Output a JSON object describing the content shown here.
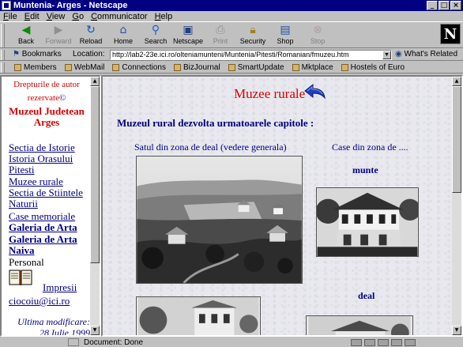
{
  "window": {
    "title": "Muntenia- Arges - Netscape"
  },
  "menu": [
    "File",
    "Edit",
    "View",
    "Go",
    "Communicator",
    "Help"
  ],
  "toolbar": {
    "buttons": [
      {
        "label": "Back",
        "icon": "back-arrow-icon",
        "enabled": true
      },
      {
        "label": "Forward",
        "icon": "forward-arrow-icon",
        "enabled": false
      },
      {
        "label": "Reload",
        "icon": "reload-icon",
        "enabled": true
      },
      {
        "label": "Home",
        "icon": "home-icon",
        "enabled": true
      },
      {
        "label": "Search",
        "icon": "search-icon",
        "enabled": true
      },
      {
        "label": "Netscape",
        "icon": "netscape-icon",
        "enabled": true
      },
      {
        "label": "Print",
        "icon": "print-icon",
        "enabled": false
      },
      {
        "label": "Security",
        "icon": "security-lock-icon",
        "enabled": true
      },
      {
        "label": "Shop",
        "icon": "shop-icon",
        "enabled": true
      },
      {
        "label": "Stop",
        "icon": "stop-icon",
        "enabled": false
      }
    ],
    "logo": "N"
  },
  "location": {
    "bookmarks_label": "Bookmarks",
    "label": "Location:",
    "url": "http://lab2-23e.ici.ro/olteniamunteni/Muntenia/Pitesti/Romanian/fmuzeu.htm",
    "related_label": "What's Related"
  },
  "personal_toolbar": [
    "Members",
    "WebMail",
    "Connections",
    "BizJournal",
    "SmartUpdate",
    "Mktplace",
    "Hostels of Euro"
  ],
  "sidebar": {
    "rights_line1": "Drepturile de autor",
    "rights_line2": "rezervate",
    "copyright": "©",
    "museum_line1": "Muzeul  Judetean",
    "museum_line2": "Arges",
    "links": [
      {
        "label": "Sectia de Istorie",
        "bold": false,
        "link": true
      },
      {
        "label": "Istoria Orasului",
        "bold": false,
        "link": true
      },
      {
        "label": "Pitesti",
        "bold": false,
        "link": true
      },
      {
        "label": "Muzee rurale",
        "bold": false,
        "link": true
      },
      {
        "label": "Sectia de Stiintele",
        "bold": false,
        "link": true
      },
      {
        "label": "Naturii",
        "bold": false,
        "link": true
      },
      {
        "label": "Case memoriale",
        "bold": false,
        "link": true
      },
      {
        "label": "Galeria de Arta",
        "bold": true,
        "link": true
      },
      {
        "label": "Galeria de Arta",
        "bold": true,
        "link": true
      },
      {
        "label": "Naiva",
        "bold": true,
        "link": true
      },
      {
        "label": "Personal",
        "bold": false,
        "link": false
      }
    ],
    "impresii": "Impresii",
    "email": "ciocoiu@ici.ro",
    "modified_line1": "Ultima modificare:",
    "modified_line2": "28 Iulie 1999"
  },
  "main": {
    "title": "Muzee rurale",
    "intro": "Muzeul rural dezvolta urmatoarele capitole :",
    "caption_left": "Satul din zona de deal (vedere generala)",
    "caption_right": "Case din zona de ....",
    "caption_munte": "munte",
    "caption_deal": "deal"
  },
  "status": {
    "text": "Document: Done"
  },
  "colors": {
    "title_red": "#e00000",
    "link_blue": "#000080",
    "titlebar": "#000080"
  }
}
